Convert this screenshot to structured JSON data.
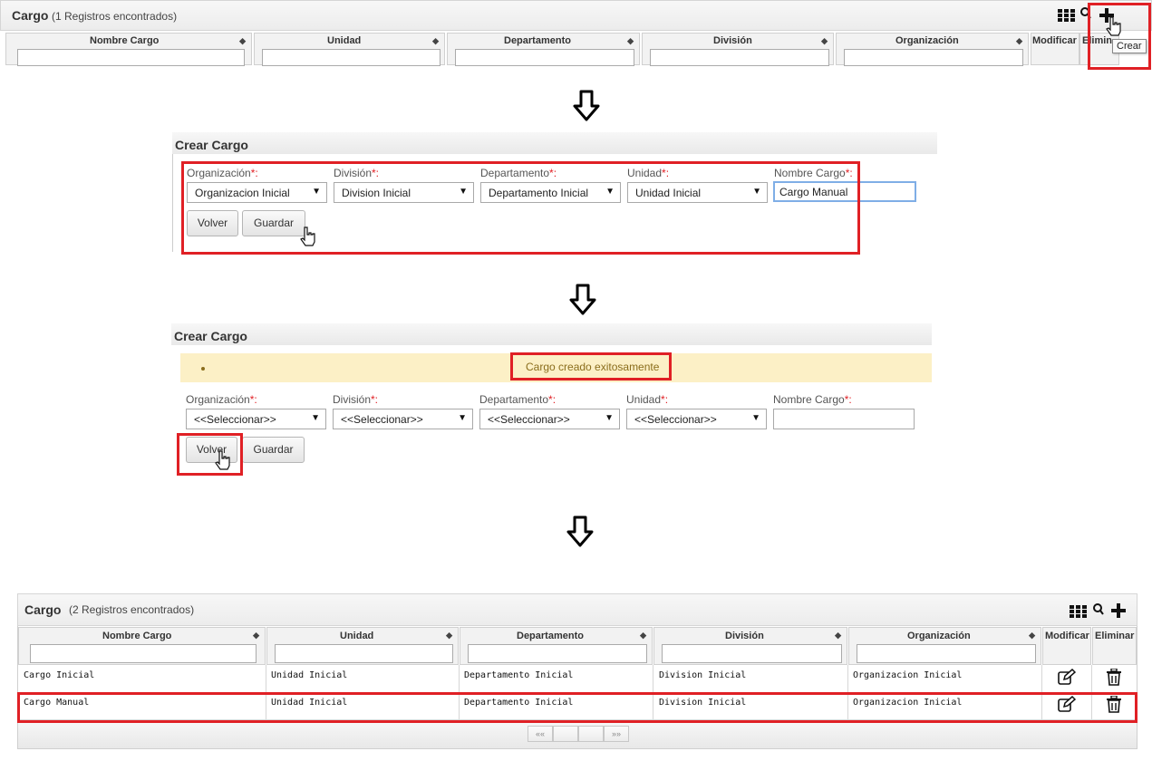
{
  "grid_top": {
    "title": "Cargo",
    "count": "(1 Registros encontrados)",
    "columns": [
      "Nombre Cargo",
      "Unidad",
      "Departamento",
      "División",
      "Organización"
    ],
    "modificar": "Modificar",
    "eliminar": "Elimin",
    "tooltip": "Crear"
  },
  "form1": {
    "title": "Crear Cargo",
    "labels": {
      "org": "Organización",
      "div": "División",
      "dep": "Departamento",
      "uni": "Unidad",
      "nom": "Nombre Cargo"
    },
    "required_mark": "*:",
    "values": {
      "org": "Organizacion Inicial",
      "div": "Division Inicial",
      "dep": "Departamento Inicial",
      "uni": "Unidad Inicial",
      "nom": "Cargo Manual"
    },
    "volver": "Volver",
    "guardar": "Guardar"
  },
  "form2": {
    "title": "Crear Cargo",
    "message": "Cargo creado exitosamente",
    "labels": {
      "org": "Organización",
      "div": "División",
      "dep": "Departamento",
      "uni": "Unidad",
      "nom": "Nombre Cargo"
    },
    "required_mark": "*:",
    "placeholder_select": "<<Seleccionar>>",
    "nom_value": "",
    "volver": "Volver",
    "guardar": "Guardar"
  },
  "grid_bottom": {
    "title": "Cargo",
    "count": "(2 Registros encontrados)",
    "columns": [
      "Nombre Cargo",
      "Unidad",
      "Departamento",
      "División",
      "Organización"
    ],
    "modificar": "Modificar",
    "eliminar": "Eliminar",
    "rows": [
      [
        "Cargo Inicial",
        "Unidad Inicial",
        "Departamento Inicial",
        "Division Inicial",
        "Organizacion Inicial"
      ],
      [
        "Cargo Manual",
        "Unidad Inicial",
        "Departamento Inicial",
        "Division Inicial",
        "Organizacion Inicial"
      ]
    ],
    "pager": {
      "first": "««",
      "last": "»»"
    }
  },
  "colors": {
    "highlight": "#e02025",
    "message_bg": "#fcf0c6",
    "focus": "#7faee6"
  },
  "icons": [
    "columns-grid-icon",
    "search-icon",
    "plus-icon",
    "hand-cursor-icon",
    "down-arrow-icon",
    "edit-icon",
    "trash-icon"
  ]
}
